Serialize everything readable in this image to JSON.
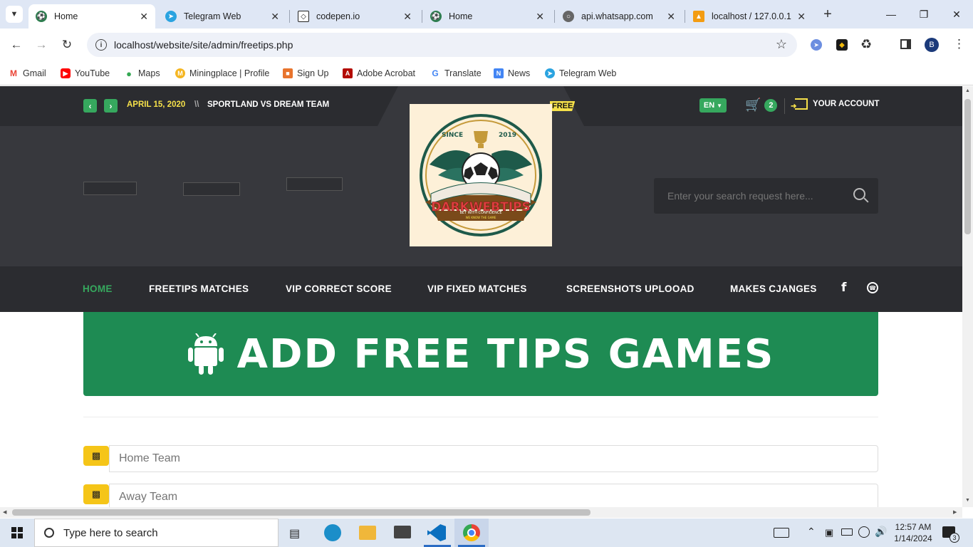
{
  "browser": {
    "tabs": [
      {
        "title": "Home",
        "active": true
      },
      {
        "title": "Telegram Web",
        "active": false
      },
      {
        "title": "codepen.io",
        "active": false
      },
      {
        "title": "Home",
        "active": false
      },
      {
        "title": "api.whatsapp.com",
        "active": false
      },
      {
        "title": "localhost / 127.0.0.1 /",
        "active": false
      }
    ],
    "url": "localhost/website/site/admin/freetips.php",
    "profile_initial": "B",
    "bookmarks": [
      "Gmail",
      "YouTube",
      "Maps",
      "Miningplace | Profile",
      "Sign Up",
      "Adobe Acrobat",
      "Translate",
      "News",
      "Telegram Web"
    ]
  },
  "site": {
    "topbar": {
      "date": "APRIL 15, 2020",
      "separator": "\\\\",
      "match": "SPORTLAND VS DREAM TEAM",
      "ribbon": "FREE",
      "language": "EN",
      "cart_count": "2",
      "account": "YOUR ACCOUNT"
    },
    "logo": {
      "top_left": "SINCE",
      "top_right": "2019",
      "name": "DARKWEBTIPS",
      "tagline": "BET WITH CONFIDENCE",
      "subline": "WE KNOW THE GAME"
    },
    "search_placeholder": "Enter your search request here...",
    "nav": [
      "HOME",
      "FREETIPS MATCHES",
      "VIP CORRECT SCORE",
      "VIP FIXED MATCHES",
      "SCREENSHOTS UPLOOAD",
      "MAKES CJANGES"
    ],
    "banner": "ADD FREE TIPS GAMES",
    "form": {
      "home_placeholder": "Home Team",
      "away_placeholder": "Away Team"
    }
  },
  "taskbar": {
    "search_placeholder": "Type here to search",
    "time": "12:57 AM",
    "date": "1/14/2024",
    "notification_count": "3"
  },
  "colors": {
    "accent_green": "#1e8b53",
    "nav_active": "#36a85e",
    "header_dark": "#2b2c30",
    "header_mid": "#37383d",
    "highlight_yellow": "#f5e04a"
  }
}
